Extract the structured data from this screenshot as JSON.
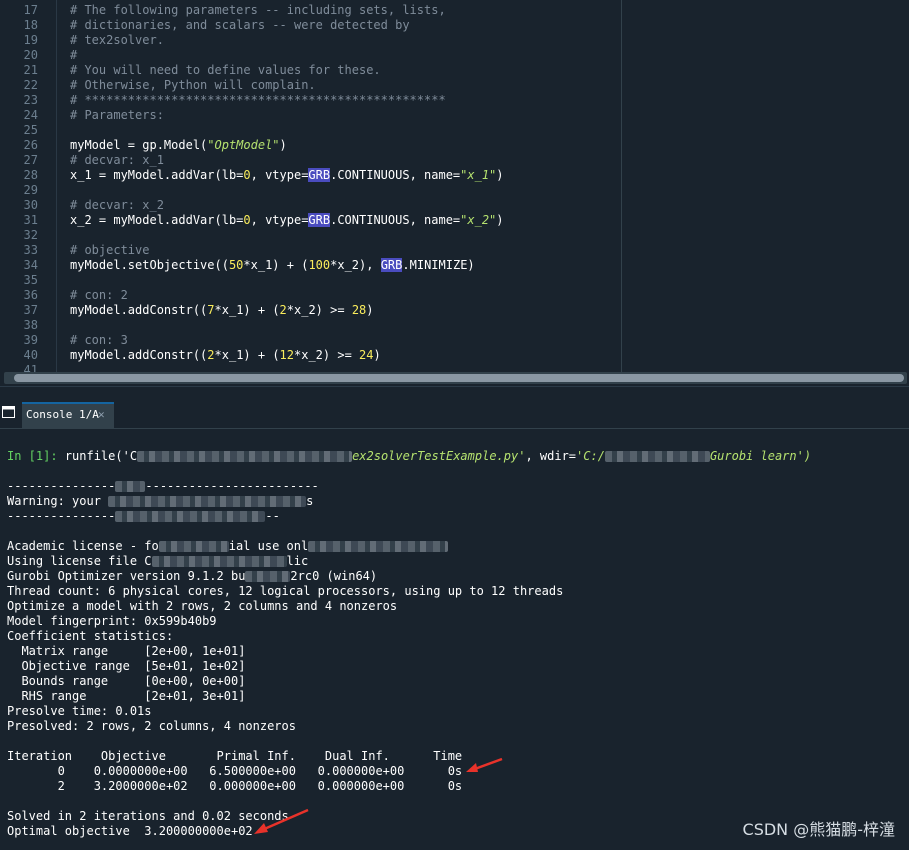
{
  "editor": {
    "lines": [
      {
        "n": "17",
        "t": "# The following parameters -- including sets, lists,"
      },
      {
        "n": "18",
        "t": "# dictionaries, and scalars -- were detected by"
      },
      {
        "n": "19",
        "t": "# tex2solver."
      },
      {
        "n": "20",
        "t": "#"
      },
      {
        "n": "21",
        "t": "# You will need to define values for these."
      },
      {
        "n": "22",
        "t": "# Otherwise, Python will complain."
      },
      {
        "n": "23",
        "t": "# **************************************************"
      },
      {
        "n": "24",
        "t": "# Parameters:"
      },
      {
        "n": "25",
        "t": ""
      },
      {
        "n": "26",
        "t": "myModel = gp.Model(\"OptModel\")"
      },
      {
        "n": "27",
        "t": "# decvar: x_1"
      },
      {
        "n": "28",
        "t": "x_1 = myModel.addVar(lb=0, vtype=GRB.CONTINUOUS, name=\"x_1\")"
      },
      {
        "n": "29",
        "t": ""
      },
      {
        "n": "30",
        "t": "# decvar: x_2"
      },
      {
        "n": "31",
        "t": "x_2 = myModel.addVar(lb=0, vtype=GRB.CONTINUOUS, name=\"x_2\")"
      },
      {
        "n": "32",
        "t": ""
      },
      {
        "n": "33",
        "t": "# objective"
      },
      {
        "n": "34",
        "t": "myModel.setObjective((50*x_1) + (100*x_2), GRB.MINIMIZE)"
      },
      {
        "n": "35",
        "t": ""
      },
      {
        "n": "36",
        "t": "# con: 2"
      },
      {
        "n": "37",
        "t": "myModel.addConstr((7*x_1) + (2*x_2) >= 28)"
      },
      {
        "n": "38",
        "t": ""
      },
      {
        "n": "39",
        "t": "# con: 3"
      },
      {
        "n": "40",
        "t": "myModel.addConstr((2*x_1) + (12*x_2) >= 24)"
      },
      {
        "n": "41",
        "t": ""
      }
    ]
  },
  "console_tab": {
    "label": "Console 1/A",
    "close": "✕"
  },
  "console": {
    "prompt": "In [1]:",
    "runfile_call": "runfile('C",
    "runfile_file": "ex2solverTestExample.py'",
    "runfile_wdir_key": ", wdir=",
    "runfile_wdir_start": "'C:/",
    "runfile_wdir_end": "Gurobi learn')",
    "dash_left": "---------------",
    "dash_right": "------------------------",
    "warning_prefix": "Warning: your",
    "warning_suffix": "s",
    "dash_left2": "---------------",
    "dash_right2": "--",
    "license_prefix": "Academic license - fo",
    "license_mid": "ial use onl",
    "using_prefix": "Using license file C",
    "using_suffix": "lic",
    "gurobi_prefix": "Gurobi Optimizer version 9.1.2 bu",
    "gurobi_suffix": "2rc0 (win64)",
    "output_lines": [
      "Thread count: 6 physical cores, 12 logical processors, using up to 12 threads",
      "Optimize a model with 2 rows, 2 columns and 4 nonzeros",
      "Model fingerprint: 0x599b40b9",
      "Coefficient statistics:",
      "  Matrix range     [2e+00, 1e+01]",
      "  Objective range  [5e+01, 1e+02]",
      "  Bounds range     [0e+00, 0e+00]",
      "  RHS range        [2e+01, 3e+01]",
      "Presolve time: 0.01s",
      "Presolved: 2 rows, 2 columns, 4 nonzeros",
      "",
      "Iteration    Objective       Primal Inf.    Dual Inf.      Time",
      "       0    0.0000000e+00   6.500000e+00   0.000000e+00      0s",
      "       2    3.2000000e+02   0.000000e+00   0.000000e+00      0s",
      "",
      "Solved in 2 iterations and 0.02 seconds",
      "Optimal objective  3.200000000e+02"
    ]
  },
  "watermark": "CSDN @熊猫鹏-梓潼",
  "colors": {
    "accent": "#1464a0",
    "arrow": "#e8322a",
    "grb_highlight": "#4a4cbf"
  }
}
